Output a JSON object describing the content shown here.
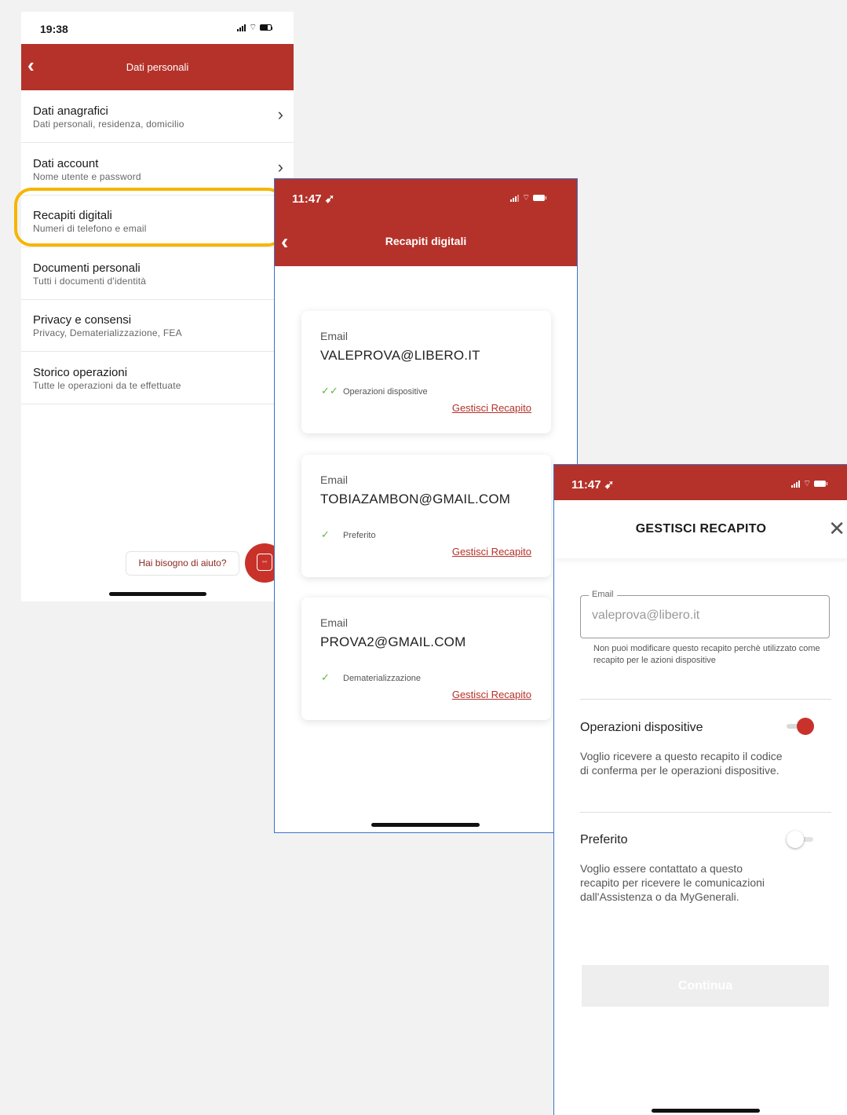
{
  "screen1": {
    "status_time": "19:38",
    "nav_title": "Dati personali",
    "items": [
      {
        "title": "Dati anagrafici",
        "subtitle": "Dati personali, residenza, domicilio"
      },
      {
        "title": "Dati account",
        "subtitle": "Nome utente e password"
      },
      {
        "title": "Recapiti digitali",
        "subtitle": "Numeri di telefono e email"
      },
      {
        "title": "Documenti personali",
        "subtitle": "Tutti i documenti d'identità"
      },
      {
        "title": "Privacy e consensi",
        "subtitle": "Privacy, Dematerializzazione, FEA"
      },
      {
        "title": "Storico operazioni",
        "subtitle": "Tutte le operazioni da te effettuate"
      }
    ],
    "help_label": "Hai bisogno di aiuto?",
    "help_fab_icon": "chatbot-icon"
  },
  "screen2": {
    "status_time": "11:47",
    "nav_title": "Recapiti digitali",
    "cards": [
      {
        "label": "Email",
        "value": "VALEPROVA@LIBERO.IT",
        "tag": "Operazioni dispositive",
        "check": "✓✓",
        "link": "Gestisci Recapito"
      },
      {
        "label": "Email",
        "value": "TOBIAZAMBON@GMAIL.COM",
        "tag": "Preferito",
        "check": "✓",
        "link": "Gestisci Recapito"
      },
      {
        "label": "Email",
        "value": "PROVA2@GMAIL.COM",
        "tag": "Dematerializzazione",
        "check": "✓",
        "link": "Gestisci Recapito"
      }
    ]
  },
  "screen3": {
    "status_time": "11:47",
    "title": "GESTISCI RECAPITO",
    "email_label": "Email",
    "email_value": "valeprova@libero.it",
    "hint": "Non puoi modificare questo recapito perchè utilizzato come recapito per le azioni dispositive",
    "options": [
      {
        "title": "Operazioni dispositive",
        "desc": "Voglio ricevere a questo recapito il codice di conferma per le operazioni dispositive.",
        "enabled": true
      },
      {
        "title": "Preferito",
        "desc": "Voglio essere contattato a questo recapito per ricevere le comunicazioni dall'Assistenza o da MyGenerali.",
        "enabled": false
      }
    ],
    "continue_label": "Continua"
  },
  "colors": {
    "brand_red": "#b5322a",
    "highlight": "#f7b500",
    "check_green": "#5fb541",
    "frame_blue": "#3a73c9"
  }
}
